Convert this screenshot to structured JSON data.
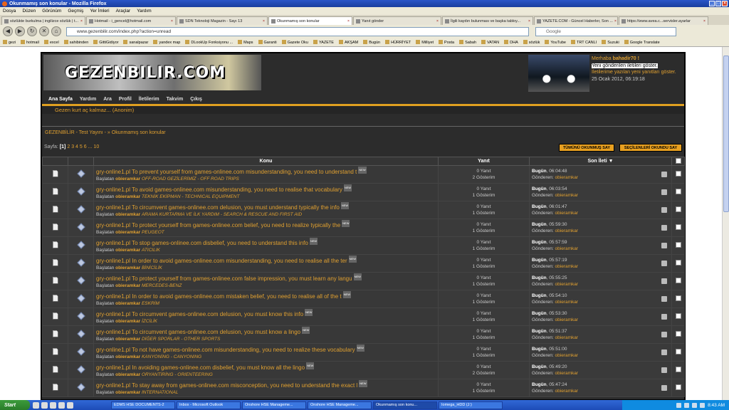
{
  "window": {
    "title": "Okunmamış son konular - Mozilla Firefox"
  },
  "menu": [
    "Dosya",
    "Düzen",
    "Görünüm",
    "Geçmiş",
    "Yer İmleri",
    "Araçlar",
    "Yardım"
  ],
  "tabs": [
    {
      "label": "sözlükte burkulma | ingilizce sözlük | t..."
    },
    {
      "label": "Hotmail - i_gencel@hotmail.com"
    },
    {
      "label": "SDN Teknoloji Magazin - Sayı 13"
    },
    {
      "label": "Okunmamış son konular"
    },
    {
      "label": "Yanıt gönder"
    },
    {
      "label": "İlgili kaydın bulunması ve başka tabloy..."
    },
    {
      "label": "YAZETE.COM - Güncel Haberler, Son ..."
    },
    {
      "label": "https://www.avea.c...servisler.ayarlar"
    }
  ],
  "nav": {
    "url": "www.gezenbilir.com/index.php?action=unread",
    "search_placeholder": "Google"
  },
  "bookmarks": [
    "gezi",
    "hotmail",
    "excel",
    "sahibinden",
    "GittiGidiyor",
    "sanalpazar",
    "yandex map",
    "DLookUp Fonksiyonu ...",
    "Maps",
    "Garanti",
    "Gazete Oku",
    "YAZETE",
    "AKŞAM",
    "Bugün",
    "HÜRRİYET",
    "Milliyet",
    "Posta",
    "Sabah",
    "VATAN",
    "DHA",
    "sözlük",
    "YouTube",
    "TRT CANLI",
    "Suzuki",
    "Google Translate"
  ],
  "forum": {
    "logo": "GEZENBILIR.COM",
    "user": {
      "greeting": "Merhaba",
      "name": "bahadir70 !",
      "msg1": "Yeni gönderilen iletileri göster.",
      "msg2": "İletilerime yazılan yeni yanıtları göster.",
      "date": "25 Ocak 2012, 06:19:18"
    },
    "navitems": [
      "Ana Sayfa",
      "Yardım",
      "Ara",
      "Profil",
      "İletilerim",
      "Takvim",
      "Çıkış"
    ],
    "slogan": "Gezen kurt aç kalmaz... (Anonim)",
    "breadcrumb": "GEZENBİLİR - Test Yayını - » Okunmamış son konular",
    "pages": {
      "label": "Sayfa:",
      "current": "[1]",
      "others": [
        "2",
        "3",
        "4",
        "5",
        "6",
        "...",
        "10"
      ]
    },
    "buttons": {
      "mark_all": "TÜMÜNÜ OKUNMUŞ SAY",
      "mark_selected": "SEÇİLENLERİ OKUNDU SAY"
    },
    "columns": {
      "topic": "Konu",
      "replies": "Yanıt",
      "last": "Son İleti ▼"
    },
    "new_badge": "NEW",
    "started_by": "Başlatan",
    "sent_by": "Gönderen:",
    "today": "Bugün",
    "topics": [
      {
        "title": "gry-online1.pl To prevent yourself from games-onlinee.com misunderstanding, you need to understand t",
        "author": "obieramkar",
        "board": "OFF-ROAD GEZİLERİMİZ - OFF ROAD TRIPS",
        "replies": "0 Yanıt",
        "views": "2 Gösterim",
        "time": ", 06:04:48",
        "by": "obieramkar"
      },
      {
        "title": "gry-online1.pl To avoid games-onlinee.com misunderstanding, you need to realise that vocabulary",
        "author": "obieramkar",
        "board": "TEKNİK EKİPMAN - TECHNICAL EQUIPMENT",
        "replies": "0 Yanıt",
        "views": "1 Gösterim",
        "time": ", 06:03:54",
        "by": "obieramkar"
      },
      {
        "title": "gry-online1.pl To circumvent games-onlinee.com delusion, you must understand typically the info",
        "author": "obieramkar",
        "board": "ARAMA KURTARMA VE İLK YARDIM - SEARCH & RESCUE AND FIRST AID",
        "replies": "0 Yanıt",
        "views": "1 Gösterim",
        "time": ", 06:01:47",
        "by": "obieramkar"
      },
      {
        "title": "gry-online1.pl To protect yourself from games-onlinee.com belief, you need to realize typically the",
        "author": "obieramkar",
        "board": "PEUGEOT",
        "replies": "0 Yanıt",
        "views": "1 Gösterim",
        "time": ", 05:59:30",
        "by": "obieramkar"
      },
      {
        "title": "gry-online1.pl To stop games-onlinee.com disbelief, you need to understand this info",
        "author": "obieramkar",
        "board": "ATICILIK",
        "replies": "0 Yanıt",
        "views": "1 Gösterim",
        "time": ", 05:57:59",
        "by": "obieramkar"
      },
      {
        "title": "gry-online1.pl In order to avoid games-onlinee.com misunderstanding, you need to realise all the ter",
        "author": "obieramkar",
        "board": "BİNİCİLİK",
        "replies": "0 Yanıt",
        "views": "1 Gösterim",
        "time": ", 05:57:19",
        "by": "obieramkar"
      },
      {
        "title": "gry-online1.pl To protect yourself from games-onlinee.com false impression, you must learn any langu",
        "author": "obieramkar",
        "board": "MERCEDES-BENZ",
        "replies": "0 Yanıt",
        "views": "1 Gösterim",
        "time": ", 05:55:25",
        "by": "obieramkar"
      },
      {
        "title": "gry-online1.pl In order to avoid games-onlinee.com mistaken belief, you need to realise all of the t",
        "author": "obieramkar",
        "board": "ESKRİM",
        "replies": "0 Yanıt",
        "views": "1 Gösterim",
        "time": ", 05:54:10",
        "by": "obieramkar"
      },
      {
        "title": "gry-online1.pl To circumvent games-onlinee.com delusion, you must know this info",
        "author": "obieramkar",
        "board": "İZCİLİK",
        "replies": "0 Yanıt",
        "views": "1 Gösterim",
        "time": ", 05:53:30",
        "by": "obieramkar"
      },
      {
        "title": "gry-online1.pl To circumvent games-onlinee.com delusion, you must know a lingo",
        "author": "obieramkar",
        "board": "DİĞER SPORLAR - OTHER SPORTS",
        "replies": "0 Yanıt",
        "views": "1 Gösterim",
        "time": ", 05:51:37",
        "by": "obieramkar"
      },
      {
        "title": "gry-online1.pl To not have games-onlinee.com misunderstanding, you need to realize these vocabulary",
        "author": "obieramkar",
        "board": "KANYONİNG - CANYONING",
        "replies": "0 Yanıt",
        "views": "1 Gösterim",
        "time": ", 05:51:00",
        "by": "obieramkar"
      },
      {
        "title": "gry-online1.pl In avoiding games-onlinee.com disbelief, you must know all the lingo",
        "author": "obieramkar",
        "board": "ORYANTİRİNG - ORIENTEERING",
        "replies": "0 Yanıt",
        "views": "2 Gösterim",
        "time": ", 05:49:20",
        "by": "obieramkar"
      },
      {
        "title": "gry-online1.pl To stay away from games-onlinee.com misconception, you need to understand the exact l",
        "author": "obieramkar",
        "board": "INTERNATIONAL",
        "replies": "0 Yanıt",
        "views": "1 Gösterim",
        "time": ", 05:47:24",
        "by": "obieramkar"
      }
    ]
  },
  "taskbar": {
    "start": "Start",
    "tasks": [
      "EDMS HSE DOCUMENTS-2",
      "Inbox - Microsoft Outlook",
      "Onshore HSE Manageme...",
      "Onshore HSE Manageme...",
      "Okunmamış son konu...",
      "Iomega_HDD (J:)"
    ],
    "clock": "8:43 AM"
  }
}
